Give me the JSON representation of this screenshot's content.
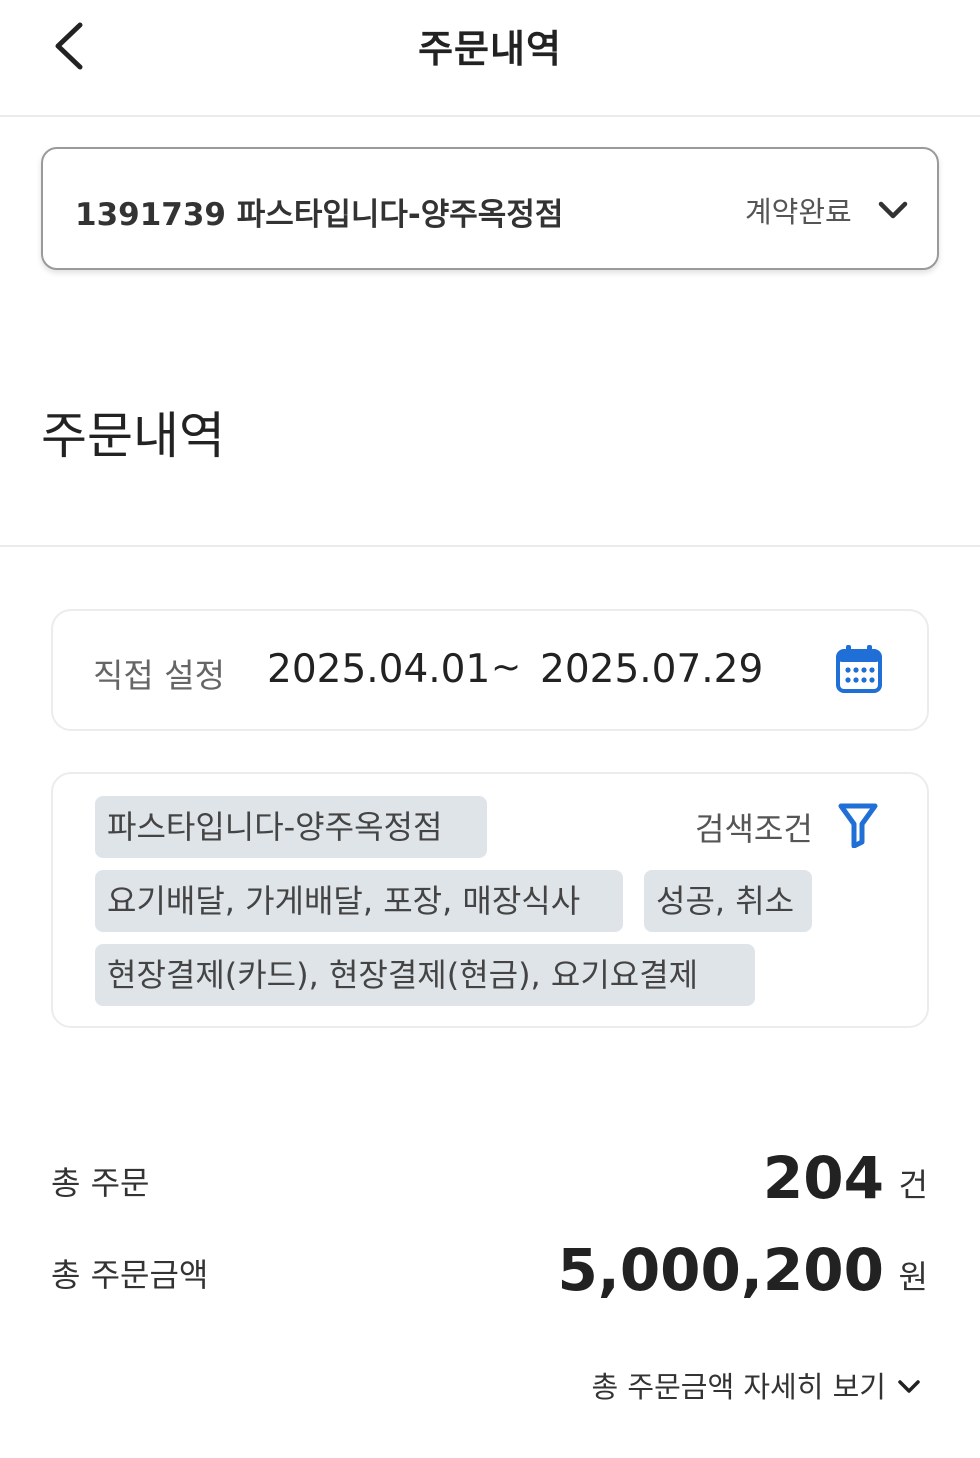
{
  "header": {
    "title": "주문내역",
    "back_icon": "chevron-left-icon"
  },
  "store_select": {
    "store_name": "1391739 파스타입니다-양주옥정점",
    "status": "계약완료",
    "chevron_icon": "chevron-down-icon"
  },
  "section": {
    "title": "주문내역"
  },
  "date_filter": {
    "mode": "직접 설정",
    "start": "2025.04.01",
    "separator": "~",
    "end": "2025.07.29",
    "icon": "calendar-icon",
    "icon_color": "#1f6fd6"
  },
  "search_filter": {
    "chips": {
      "store": "파스타입니다-양주옥정점",
      "order_type": "요기배달, 가게배달, 포장, 매장식사",
      "order_state": "성공, 취소",
      "payment": "현장결제(카드), 현장결제(현금), 요기요결제"
    },
    "label": "검색조건",
    "icon": "filter-icon",
    "icon_color": "#1f6fd6"
  },
  "summary": {
    "total_orders_label": "총 주문",
    "total_orders_value": "204",
    "total_orders_unit": "건",
    "total_amount_label": "총 주문금액",
    "total_amount_value": "5,000,200",
    "total_amount_unit": "원",
    "detail_link": "총 주문금액 자세히 보기"
  }
}
